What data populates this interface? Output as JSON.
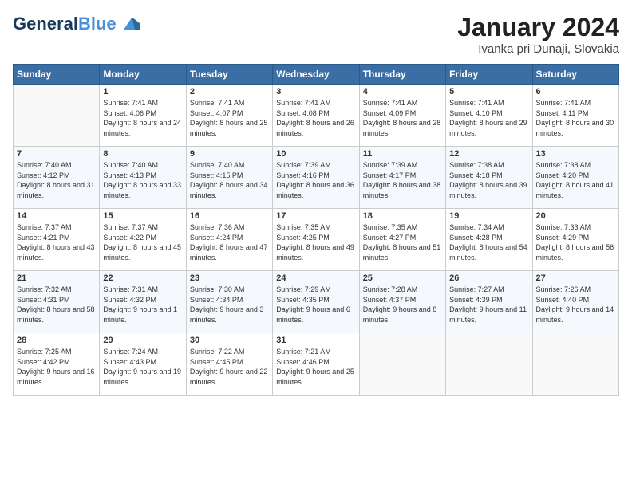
{
  "header": {
    "logo_line1": "General",
    "logo_line2": "Blue",
    "month_title": "January 2024",
    "location": "Ivanka pri Dunaji, Slovakia"
  },
  "weekdays": [
    "Sunday",
    "Monday",
    "Tuesday",
    "Wednesday",
    "Thursday",
    "Friday",
    "Saturday"
  ],
  "weeks": [
    [
      {
        "day": "",
        "sunrise": "",
        "sunset": "",
        "daylight": ""
      },
      {
        "day": "1",
        "sunrise": "Sunrise: 7:41 AM",
        "sunset": "Sunset: 4:06 PM",
        "daylight": "Daylight: 8 hours and 24 minutes."
      },
      {
        "day": "2",
        "sunrise": "Sunrise: 7:41 AM",
        "sunset": "Sunset: 4:07 PM",
        "daylight": "Daylight: 8 hours and 25 minutes."
      },
      {
        "day": "3",
        "sunrise": "Sunrise: 7:41 AM",
        "sunset": "Sunset: 4:08 PM",
        "daylight": "Daylight: 8 hours and 26 minutes."
      },
      {
        "day": "4",
        "sunrise": "Sunrise: 7:41 AM",
        "sunset": "Sunset: 4:09 PM",
        "daylight": "Daylight: 8 hours and 28 minutes."
      },
      {
        "day": "5",
        "sunrise": "Sunrise: 7:41 AM",
        "sunset": "Sunset: 4:10 PM",
        "daylight": "Daylight: 8 hours and 29 minutes."
      },
      {
        "day": "6",
        "sunrise": "Sunrise: 7:41 AM",
        "sunset": "Sunset: 4:11 PM",
        "daylight": "Daylight: 8 hours and 30 minutes."
      }
    ],
    [
      {
        "day": "7",
        "sunrise": "Sunrise: 7:40 AM",
        "sunset": "Sunset: 4:12 PM",
        "daylight": "Daylight: 8 hours and 31 minutes."
      },
      {
        "day": "8",
        "sunrise": "Sunrise: 7:40 AM",
        "sunset": "Sunset: 4:13 PM",
        "daylight": "Daylight: 8 hours and 33 minutes."
      },
      {
        "day": "9",
        "sunrise": "Sunrise: 7:40 AM",
        "sunset": "Sunset: 4:15 PM",
        "daylight": "Daylight: 8 hours and 34 minutes."
      },
      {
        "day": "10",
        "sunrise": "Sunrise: 7:39 AM",
        "sunset": "Sunset: 4:16 PM",
        "daylight": "Daylight: 8 hours and 36 minutes."
      },
      {
        "day": "11",
        "sunrise": "Sunrise: 7:39 AM",
        "sunset": "Sunset: 4:17 PM",
        "daylight": "Daylight: 8 hours and 38 minutes."
      },
      {
        "day": "12",
        "sunrise": "Sunrise: 7:38 AM",
        "sunset": "Sunset: 4:18 PM",
        "daylight": "Daylight: 8 hours and 39 minutes."
      },
      {
        "day": "13",
        "sunrise": "Sunrise: 7:38 AM",
        "sunset": "Sunset: 4:20 PM",
        "daylight": "Daylight: 8 hours and 41 minutes."
      }
    ],
    [
      {
        "day": "14",
        "sunrise": "Sunrise: 7:37 AM",
        "sunset": "Sunset: 4:21 PM",
        "daylight": "Daylight: 8 hours and 43 minutes."
      },
      {
        "day": "15",
        "sunrise": "Sunrise: 7:37 AM",
        "sunset": "Sunset: 4:22 PM",
        "daylight": "Daylight: 8 hours and 45 minutes."
      },
      {
        "day": "16",
        "sunrise": "Sunrise: 7:36 AM",
        "sunset": "Sunset: 4:24 PM",
        "daylight": "Daylight: 8 hours and 47 minutes."
      },
      {
        "day": "17",
        "sunrise": "Sunrise: 7:35 AM",
        "sunset": "Sunset: 4:25 PM",
        "daylight": "Daylight: 8 hours and 49 minutes."
      },
      {
        "day": "18",
        "sunrise": "Sunrise: 7:35 AM",
        "sunset": "Sunset: 4:27 PM",
        "daylight": "Daylight: 8 hours and 51 minutes."
      },
      {
        "day": "19",
        "sunrise": "Sunrise: 7:34 AM",
        "sunset": "Sunset: 4:28 PM",
        "daylight": "Daylight: 8 hours and 54 minutes."
      },
      {
        "day": "20",
        "sunrise": "Sunrise: 7:33 AM",
        "sunset": "Sunset: 4:29 PM",
        "daylight": "Daylight: 8 hours and 56 minutes."
      }
    ],
    [
      {
        "day": "21",
        "sunrise": "Sunrise: 7:32 AM",
        "sunset": "Sunset: 4:31 PM",
        "daylight": "Daylight: 8 hours and 58 minutes."
      },
      {
        "day": "22",
        "sunrise": "Sunrise: 7:31 AM",
        "sunset": "Sunset: 4:32 PM",
        "daylight": "Daylight: 9 hours and 1 minute."
      },
      {
        "day": "23",
        "sunrise": "Sunrise: 7:30 AM",
        "sunset": "Sunset: 4:34 PM",
        "daylight": "Daylight: 9 hours and 3 minutes."
      },
      {
        "day": "24",
        "sunrise": "Sunrise: 7:29 AM",
        "sunset": "Sunset: 4:35 PM",
        "daylight": "Daylight: 9 hours and 6 minutes."
      },
      {
        "day": "25",
        "sunrise": "Sunrise: 7:28 AM",
        "sunset": "Sunset: 4:37 PM",
        "daylight": "Daylight: 9 hours and 8 minutes."
      },
      {
        "day": "26",
        "sunrise": "Sunrise: 7:27 AM",
        "sunset": "Sunset: 4:39 PM",
        "daylight": "Daylight: 9 hours and 11 minutes."
      },
      {
        "day": "27",
        "sunrise": "Sunrise: 7:26 AM",
        "sunset": "Sunset: 4:40 PM",
        "daylight": "Daylight: 9 hours and 14 minutes."
      }
    ],
    [
      {
        "day": "28",
        "sunrise": "Sunrise: 7:25 AM",
        "sunset": "Sunset: 4:42 PM",
        "daylight": "Daylight: 9 hours and 16 minutes."
      },
      {
        "day": "29",
        "sunrise": "Sunrise: 7:24 AM",
        "sunset": "Sunset: 4:43 PM",
        "daylight": "Daylight: 9 hours and 19 minutes."
      },
      {
        "day": "30",
        "sunrise": "Sunrise: 7:22 AM",
        "sunset": "Sunset: 4:45 PM",
        "daylight": "Daylight: 9 hours and 22 minutes."
      },
      {
        "day": "31",
        "sunrise": "Sunrise: 7:21 AM",
        "sunset": "Sunset: 4:46 PM",
        "daylight": "Daylight: 9 hours and 25 minutes."
      },
      {
        "day": "",
        "sunrise": "",
        "sunset": "",
        "daylight": ""
      },
      {
        "day": "",
        "sunrise": "",
        "sunset": "",
        "daylight": ""
      },
      {
        "day": "",
        "sunrise": "",
        "sunset": "",
        "daylight": ""
      }
    ]
  ]
}
